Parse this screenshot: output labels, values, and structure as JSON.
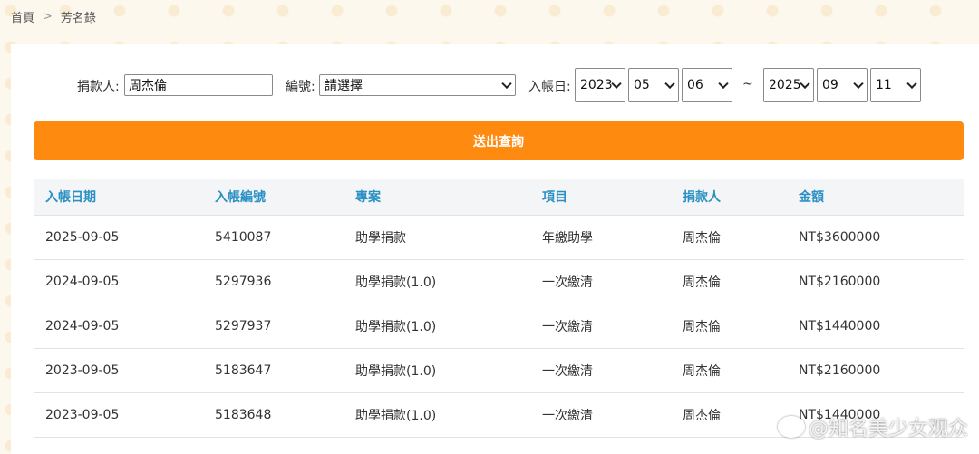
{
  "breadcrumb": {
    "home": "首頁",
    "separator": ">",
    "current": "芳名錄"
  },
  "search": {
    "donor_label": "捐款人:",
    "donor_value": "周杰倫",
    "number_label": "編號:",
    "number_value": "請選擇",
    "date_label": "入帳日:",
    "date_from": {
      "year": "2023",
      "month": "05",
      "day": "06"
    },
    "date_separator": "~",
    "date_to": {
      "year": "2025",
      "month": "09",
      "day": "11"
    }
  },
  "submit_label": "送出查詢",
  "table": {
    "headers": [
      "入帳日期",
      "入帳編號",
      "專案",
      "項目",
      "捐款人",
      "金額"
    ],
    "rows": [
      [
        "2025-09-05",
        "5410087",
        "助學捐款",
        "年繳助學",
        "周杰倫",
        "NT$3600000"
      ],
      [
        "2024-09-05",
        "5297936",
        "助學捐款(1.0)",
        "一次繳清",
        "周杰倫",
        "NT$2160000"
      ],
      [
        "2024-09-05",
        "5297937",
        "助學捐款(1.0)",
        "一次繳清",
        "周杰倫",
        "NT$1440000"
      ],
      [
        "2023-09-05",
        "5183647",
        "助學捐款(1.0)",
        "一次繳清",
        "周杰倫",
        "NT$2160000"
      ],
      [
        "2023-09-05",
        "5183648",
        "助學捐款(1.0)",
        "一次繳清",
        "周杰倫",
        "NT$1440000"
      ]
    ]
  },
  "watermark": "@知名美少女观众",
  "colors": {
    "accent": "#ff8a10",
    "header_text": "#2a8fc4"
  }
}
